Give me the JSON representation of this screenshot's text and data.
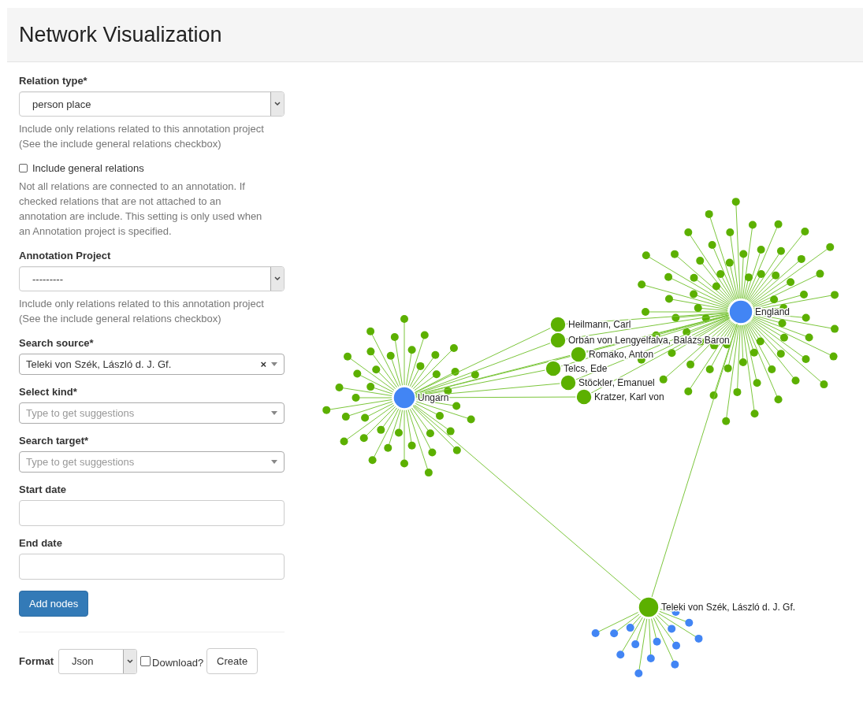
{
  "header": {
    "title": "Network Visualization"
  },
  "fields": [
    {
      "kind": "select",
      "label": "Relation type*",
      "value": "person place",
      "help": [
        "Include only relations related to this annotation project",
        "(See the include general relations checkbox)"
      ]
    },
    {
      "kind": "checkbox",
      "label": "Include general relations",
      "checked": false,
      "help": [
        "Not all relations are connected to an annotation. If",
        "checked relations that are not attached to an",
        "annotation are include. This setting is only used when",
        "an Annotation project is specified."
      ]
    },
    {
      "kind": "select",
      "label": "Annotation Project",
      "value": "---------",
      "help": [
        "Include only relations related to this annotation project",
        "(See the include general relations checkbox)"
      ]
    },
    {
      "kind": "autocomplete",
      "label": "Search source*",
      "value": "Teleki von Szék, László d. J. Gf.",
      "clear": "×"
    },
    {
      "kind": "autocomplete",
      "label": "Select kind*",
      "placeholder": "Type to get suggestions"
    },
    {
      "kind": "autocomplete",
      "label": "Search target*",
      "placeholder": "Type to get suggestions"
    },
    {
      "kind": "input",
      "label": "Start date"
    },
    {
      "kind": "input",
      "label": "End date"
    }
  ],
  "add_button": "Add nodes",
  "export": {
    "label": "Format",
    "format": "Json",
    "download": {
      "label": "Download?",
      "checked": false
    },
    "button": "Create"
  },
  "graph": {
    "nodes": [
      {
        "label": "Ungarn",
        "color": "#4285f4"
      },
      {
        "label": "England",
        "color": "#4285f4"
      },
      {
        "label": "Teleki von Szék, László d. J. Gf.",
        "color": "#5cb000"
      },
      {
        "label": "Heilmann, Carl",
        "color": "#5cb000"
      },
      {
        "label": "Orbán von Lengyelfalva, Balázs Baron",
        "color": "#5cb000"
      },
      {
        "label": "Romako, Anton",
        "color": "#5cb000"
      },
      {
        "label": "Telcs, Ede",
        "color": "#5cb000"
      },
      {
        "label": "Stöckler, Emanuel",
        "color": "#5cb000"
      },
      {
        "label": "Kratzer, Karl von",
        "color": "#5cb000"
      }
    ]
  }
}
